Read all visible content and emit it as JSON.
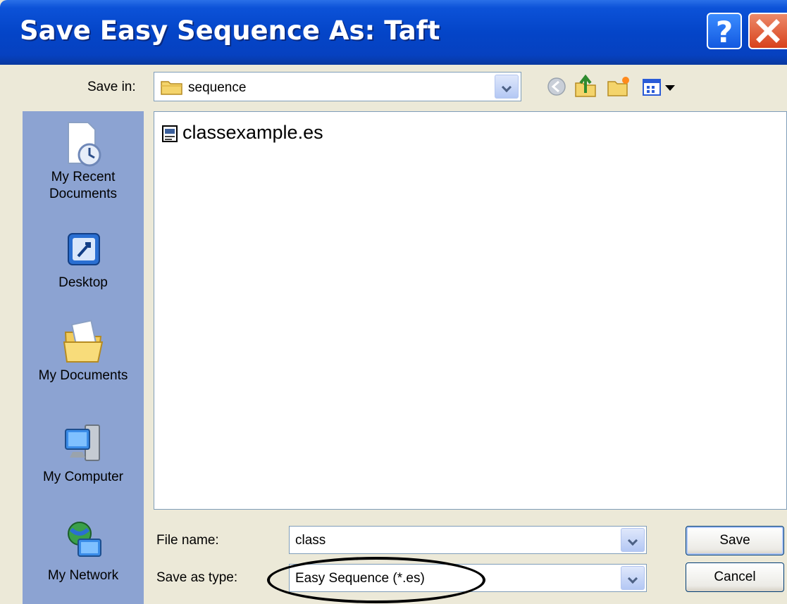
{
  "window": {
    "title": "Save Easy Sequence As: Taft"
  },
  "titlebar_buttons": {
    "help": "?",
    "close_icon": "close-icon"
  },
  "save_in": {
    "label": "Save in:",
    "value": "sequence",
    "icon": "folder-icon"
  },
  "toolbar": {
    "icons": [
      "back-icon",
      "up-folder-icon",
      "new-folder-icon",
      "views-menu-icon"
    ]
  },
  "places": [
    {
      "label_lines": [
        "My Recent",
        "Documents"
      ],
      "icon": "recent-documents-icon"
    },
    {
      "label_lines": [
        "Desktop"
      ],
      "icon": "desktop-icon"
    },
    {
      "label_lines": [
        "My Documents"
      ],
      "icon": "my-documents-icon"
    },
    {
      "label_lines": [
        "My Computer"
      ],
      "icon": "my-computer-icon"
    },
    {
      "label_lines": [
        "My Network"
      ],
      "icon": "my-network-icon"
    }
  ],
  "files": [
    {
      "name": "classexample.es",
      "icon": "sequence-file-icon"
    }
  ],
  "file_name": {
    "label": "File name:",
    "value": "class"
  },
  "save_as_type": {
    "label": "Save as type:",
    "value": "Easy Sequence (*.es)"
  },
  "buttons": {
    "save": "Save",
    "cancel": "Cancel"
  },
  "colors": {
    "titlebar": "#0445c8",
    "places_bar": "#8ca3d2",
    "dialog_bg": "#ece9d8",
    "close_button": "#d8421c"
  }
}
